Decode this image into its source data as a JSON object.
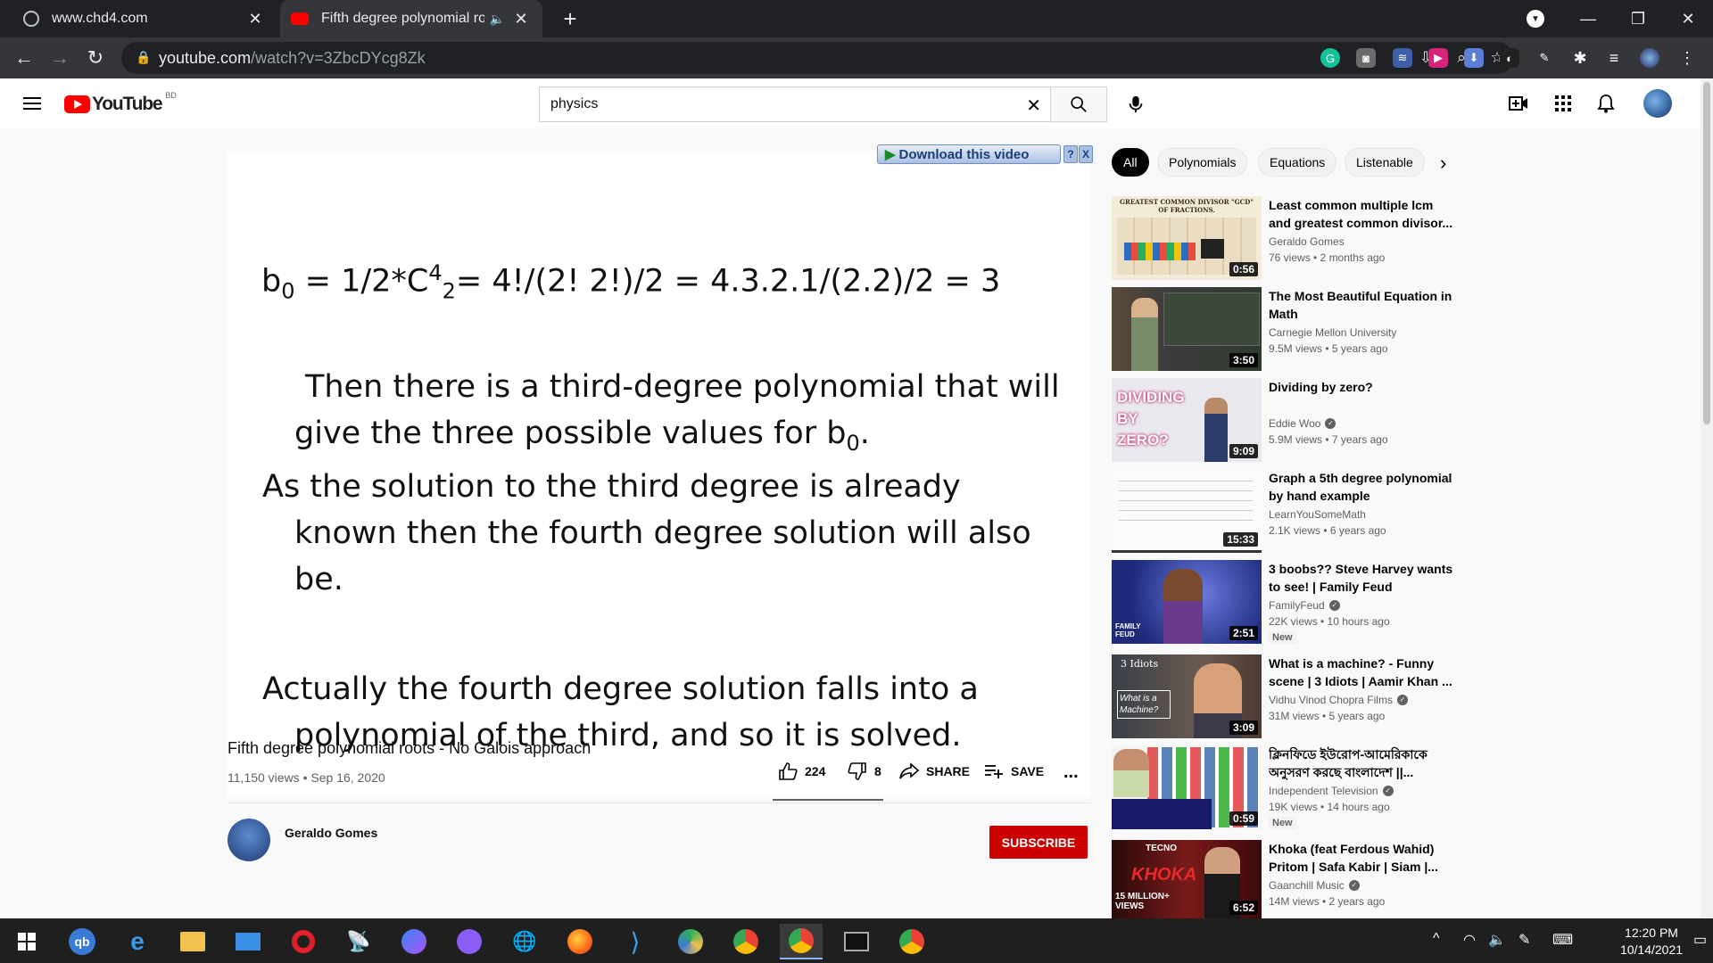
{
  "browser": {
    "tabs": [
      {
        "title": "www.chd4.com"
      },
      {
        "title": "Fifth degree polynomial root"
      }
    ],
    "new_tab": "+",
    "url_host": "youtube.com",
    "url_path": "/watch?v=3ZbcDYcg8Zk"
  },
  "youtube": {
    "logo_text": "YouTube",
    "country_code": "BD",
    "search": {
      "value": "physics"
    },
    "download_plugin": {
      "label": "Download this video",
      "help": "?",
      "close": "X"
    },
    "slide": {
      "formula_b": "b",
      "formula_sub0": "0",
      "formula_eq1": " = 1/2*C",
      "formula_sup4": "4",
      "formula_sub2": "2",
      "formula_rest": "= 4!/(2! 2!)/2 = 4.3.2.1/(2.2)/2 = 3",
      "para1_line1": "Then there is a third-degree polynomial that will",
      "para1_line2": "give the three possible values for b",
      "para1_sub": "0",
      "para1_end": ".",
      "para2_line1": "As the solution to the third degree is already",
      "para2_line2": "known then the fourth degree solution will also",
      "para2_line3": "be.",
      "para3_line1": "Actually the fourth degree solution falls into a",
      "para3_line2": "polynomial of the third, and so it is solved."
    },
    "video": {
      "title": "Fifth degree polynomial roots - No Galois approach",
      "views": "11,150 views",
      "date": "Sep 16, 2020",
      "likes": "224",
      "dislikes": "8",
      "share": "SHARE",
      "save": "SAVE",
      "more": "...",
      "channel": "Geraldo Gomes",
      "subscribe": "SUBSCRIBE"
    },
    "chips": [
      "All",
      "Polynomials",
      "Equations",
      "Listenable"
    ],
    "recommendations": [
      {
        "title": "Least common multiple lcm and greatest common divisor...",
        "channel": "Geraldo Gomes",
        "verified": false,
        "meta": "76 views • 2 months ago",
        "duration": "0:56",
        "badge": ""
      },
      {
        "title": "The Most Beautiful Equation in Math",
        "channel": "Carnegie Mellon University",
        "verified": false,
        "meta": "9.5M views • 5 years ago",
        "duration": "3:50",
        "badge": ""
      },
      {
        "title": "Dividing by zero?",
        "channel": "Eddie Woo",
        "verified": true,
        "meta": "5.9M views • 7 years ago",
        "duration": "9:09",
        "badge": ""
      },
      {
        "title": "Graph a 5th degree polynomial by hand example",
        "channel": "LearnYouSomeMath",
        "verified": false,
        "meta": "2.1K views • 6 years ago",
        "duration": "15:33",
        "badge": ""
      },
      {
        "title": "3 boobs?? Steve Harvey wants to see! | Family Feud",
        "channel": "FamilyFeud",
        "verified": true,
        "meta": "22K views • 10 hours ago",
        "duration": "2:51",
        "badge": "New"
      },
      {
        "title": "What is a machine? - Funny scene | 3 Idiots | Aamir Khan ...",
        "channel": "Vidhu Vinod Chopra Films",
        "verified": true,
        "meta": "31M views • 5 years ago",
        "duration": "3:09",
        "badge": ""
      },
      {
        "title": "ক্লিনফিডে ইউরোপ-আমেরিকাকে অনুসরণ করছে বাংলাদেশ ||...",
        "channel": "Independent Television",
        "verified": true,
        "meta": "19K views • 14 hours ago",
        "duration": "0:59",
        "badge": "New"
      },
      {
        "title": "Khoka (feat Ferdous Wahid) Pritom | Safa Kabir | Siam |...",
        "channel": "Gaanchill Music",
        "verified": true,
        "meta": "14M views • 2 years ago",
        "duration": "6:52",
        "badge": ""
      }
    ],
    "thumb_texts": {
      "t1": "GREATEST COMMON DIVISOR \"GCD\" OF FRACTIONS.",
      "t3": "DIVIDING BY ZERO?",
      "t5": "FAMILY FEUD",
      "t6a": "3 Idiots",
      "t6b": "What is a Machine?",
      "t8a": "TECNO",
      "t8b": "KHOKA",
      "t8c": "15 MILLION+ VIEWS"
    }
  },
  "taskbar": {
    "time": "12:20 PM",
    "date": "10/14/2021"
  }
}
